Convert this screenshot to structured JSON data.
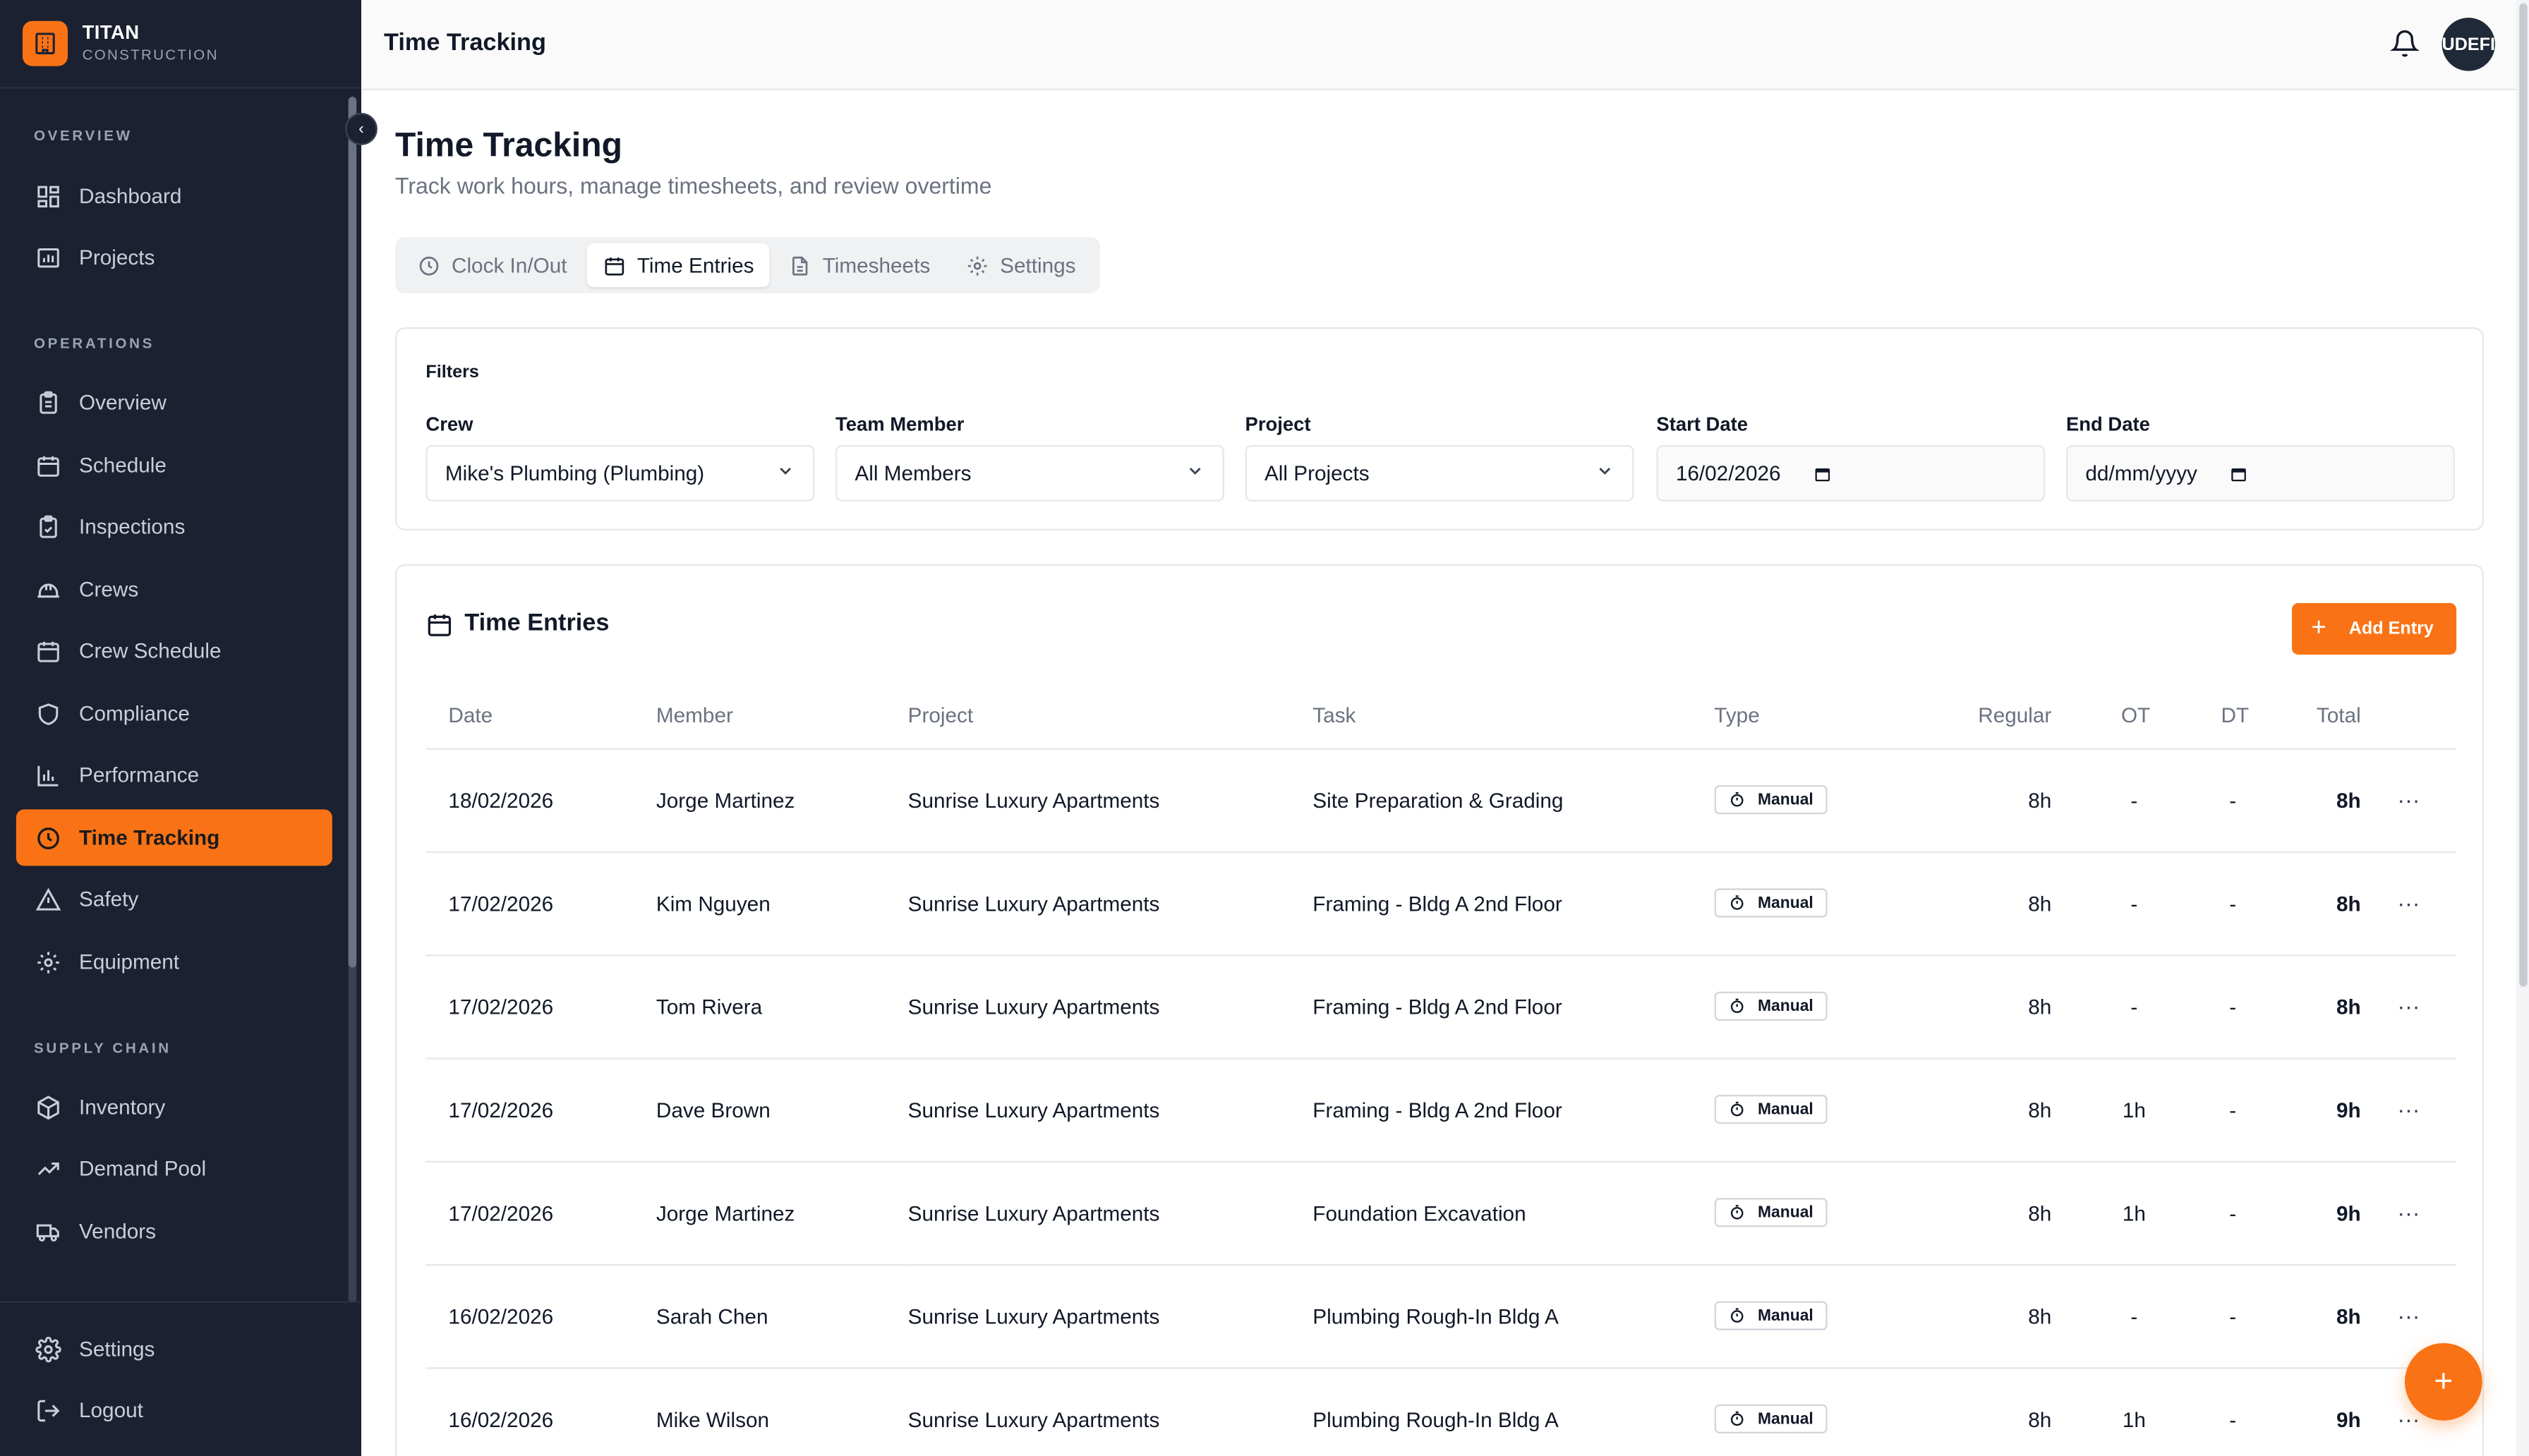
{
  "brand": {
    "name": "TITAN",
    "sub": "CONSTRUCTION"
  },
  "sidebar": {
    "sections": [
      "OVERVIEW",
      "OPERATIONS",
      "SUPPLY CHAIN"
    ],
    "items": [
      {
        "label": "Dashboard",
        "icon": "dashboard-icon"
      },
      {
        "label": "Projects",
        "icon": "projects-icon"
      },
      {
        "label": "Overview",
        "icon": "clipboard-icon"
      },
      {
        "label": "Schedule",
        "icon": "calendar-icon"
      },
      {
        "label": "Inspections",
        "icon": "clipboard-check-icon"
      },
      {
        "label": "Crews",
        "icon": "hardhat-icon"
      },
      {
        "label": "Crew Schedule",
        "icon": "calendar-grid-icon"
      },
      {
        "label": "Compliance",
        "icon": "shield-icon"
      },
      {
        "label": "Performance",
        "icon": "bar-chart-icon"
      },
      {
        "label": "Time Tracking",
        "icon": "clock-icon",
        "active": true
      },
      {
        "label": "Safety",
        "icon": "warning-icon"
      },
      {
        "label": "Equipment",
        "icon": "cog-icon"
      },
      {
        "label": "Inventory",
        "icon": "box-icon"
      },
      {
        "label": "Demand Pool",
        "icon": "trending-icon"
      },
      {
        "label": "Vendors",
        "icon": "truck-icon"
      }
    ],
    "bottom": [
      {
        "label": "Settings",
        "icon": "settings-icon"
      },
      {
        "label": "Logout",
        "icon": "logout-icon"
      }
    ]
  },
  "header": {
    "title": "Time Tracking",
    "avatar": "UDEFI"
  },
  "page": {
    "title": "Time Tracking",
    "subtitle": "Track work hours, manage timesheets, and review overtime"
  },
  "tabs": [
    {
      "label": "Clock In/Out"
    },
    {
      "label": "Time Entries",
      "active": true
    },
    {
      "label": "Timesheets"
    },
    {
      "label": "Settings"
    }
  ],
  "filters": {
    "title": "Filters",
    "crew": {
      "label": "Crew",
      "value": "Mike's Plumbing (Plumbing)"
    },
    "member": {
      "label": "Team Member",
      "value": "All Members"
    },
    "project": {
      "label": "Project",
      "value": "All Projects"
    },
    "start": {
      "label": "Start Date",
      "value": "16/02/2026"
    },
    "end": {
      "label": "End Date",
      "value": "dd/mm/yyyy"
    }
  },
  "entries": {
    "title": "Time Entries",
    "add_label": "Add Entry",
    "columns": [
      "Date",
      "Member",
      "Project",
      "Task",
      "Type",
      "Regular",
      "OT",
      "DT",
      "Total"
    ],
    "rows": [
      {
        "date": "18/02/2026",
        "member": "Jorge Martinez",
        "project": "Sunrise Luxury Apartments",
        "task": "Site Preparation & Grading",
        "type": "Manual",
        "regular": "8h",
        "ot": "-",
        "dt": "-",
        "total": "8h"
      },
      {
        "date": "17/02/2026",
        "member": "Kim Nguyen",
        "project": "Sunrise Luxury Apartments",
        "task": "Framing - Bldg A 2nd Floor",
        "type": "Manual",
        "regular": "8h",
        "ot": "-",
        "dt": "-",
        "total": "8h"
      },
      {
        "date": "17/02/2026",
        "member": "Tom Rivera",
        "project": "Sunrise Luxury Apartments",
        "task": "Framing - Bldg A 2nd Floor",
        "type": "Manual",
        "regular": "8h",
        "ot": "-",
        "dt": "-",
        "total": "8h"
      },
      {
        "date": "17/02/2026",
        "member": "Dave Brown",
        "project": "Sunrise Luxury Apartments",
        "task": "Framing - Bldg A 2nd Floor",
        "type": "Manual",
        "regular": "8h",
        "ot": "1h",
        "dt": "-",
        "total": "9h"
      },
      {
        "date": "17/02/2026",
        "member": "Jorge Martinez",
        "project": "Sunrise Luxury Apartments",
        "task": "Foundation Excavation",
        "type": "Manual",
        "regular": "8h",
        "ot": "1h",
        "dt": "-",
        "total": "9h"
      },
      {
        "date": "16/02/2026",
        "member": "Sarah Chen",
        "project": "Sunrise Luxury Apartments",
        "task": "Plumbing Rough-In Bldg A",
        "type": "Manual",
        "regular": "8h",
        "ot": "-",
        "dt": "-",
        "total": "8h"
      },
      {
        "date": "16/02/2026",
        "member": "Mike Wilson",
        "project": "Sunrise Luxury Apartments",
        "task": "Plumbing Rough-In Bldg A",
        "type": "Manual",
        "regular": "8h",
        "ot": "1h",
        "dt": "-",
        "total": "9h"
      }
    ]
  },
  "colors": {
    "accent": "#f97316",
    "sidebar_bg": "#1b2130"
  }
}
